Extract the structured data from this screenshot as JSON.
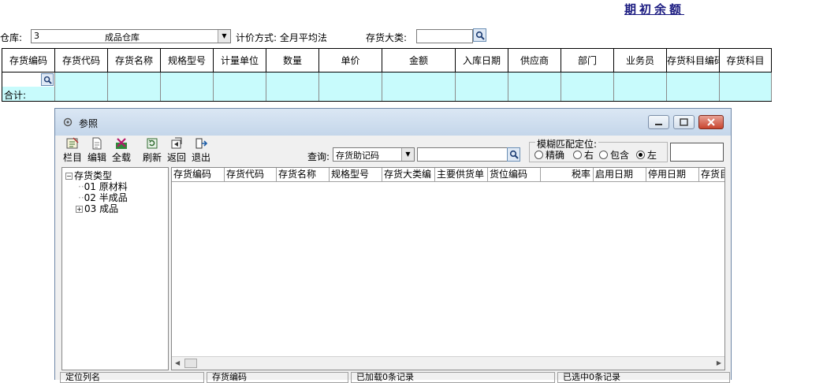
{
  "page_title": "期初余额",
  "filter_bar": {
    "warehouse_label": "仓库:",
    "warehouse_code": "3",
    "warehouse_name": "成品仓库",
    "pricing_label": "计价方式: 全月平均法",
    "category_label": "存货大类:",
    "category_value": ""
  },
  "grid": {
    "headers": [
      "存货编码",
      "存货代码",
      "存货名称",
      "规格型号",
      "计量单位",
      "数量",
      "单价",
      "金额",
      "入库日期",
      "供应商",
      "部门",
      "业务员",
      "存货科目编码",
      "存货科目"
    ],
    "total_label": "合计:"
  },
  "dialog": {
    "title": "参照",
    "toolbar": {
      "columns": "栏目",
      "edit": "编辑",
      "load_all": "全载",
      "refresh": "刷新",
      "back": "返回",
      "exit": "退出"
    },
    "query_label": "查询:",
    "query_field": "存货助记码",
    "query_value": "",
    "fuzzy_title": "模糊匹配定位:",
    "fuzzy_options": [
      "精确",
      "右",
      "包含",
      "左"
    ],
    "fuzzy_selected": "左",
    "locate_value": "",
    "tree": {
      "root": "存货类型",
      "children": [
        "01 原材料",
        "02 半成品",
        "03 成品"
      ]
    },
    "list_headers": [
      "存货编码",
      "存货代码",
      "存货名称",
      "规格型号",
      "存货大类编",
      "主要供货单",
      "货位编码",
      "税率",
      "启用日期",
      "停用日期",
      "存货目"
    ],
    "status": [
      "定位列名",
      "存货编码",
      "已加载0条记录",
      "已选中0条记录"
    ]
  },
  "colors": {
    "grid_fill": "#c8fbfc",
    "title_color": "#1a1a80",
    "close_button": "#c8452f"
  }
}
